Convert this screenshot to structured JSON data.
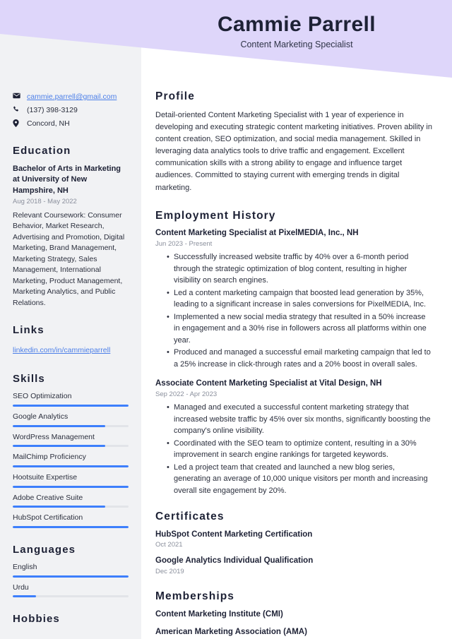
{
  "header": {
    "name": "Cammie Parrell",
    "job_title": "Content Marketing Specialist",
    "band_color": "#ded6fa"
  },
  "theme": {
    "accent": "#3d7ffc",
    "link": "#4c7fe8",
    "sidebar_bg": "#f1f2f4",
    "text": "#2b2f3d",
    "muted": "#8a8f9c"
  },
  "sidebar": {
    "contact": [
      {
        "icon": "envelope-icon",
        "value": "cammie.parrell@gmail.com",
        "is_link": true
      },
      {
        "icon": "phone-icon",
        "value": "(137) 398-3129",
        "is_link": false
      },
      {
        "icon": "location-pin-icon",
        "value": "Concord, NH",
        "is_link": false
      }
    ],
    "education": {
      "heading": "Education",
      "degree": "Bachelor of Arts in Marketing at University of New Hampshire, NH",
      "date": "Aug 2018 - May 2022",
      "description": "Relevant Coursework: Consumer Behavior, Market Research, Advertising and Promotion, Digital Marketing, Brand Management, Marketing Strategy, Sales Management, International Marketing, Product Management, Marketing Analytics, and Public Relations."
    },
    "links": {
      "heading": "Links",
      "items": [
        {
          "label": "linkedin.com/in/cammieparrell"
        }
      ]
    },
    "skills": {
      "heading": "Skills",
      "items": [
        {
          "label": "SEO Optimization",
          "level": 100
        },
        {
          "label": "Google Analytics",
          "level": 80
        },
        {
          "label": "WordPress Management",
          "level": 80
        },
        {
          "label": "MailChimp Proficiency",
          "level": 100
        },
        {
          "label": "Hootsuite Expertise",
          "level": 100
        },
        {
          "label": "Adobe Creative Suite",
          "level": 80
        },
        {
          "label": "HubSpot Certification",
          "level": 100
        }
      ]
    },
    "languages": {
      "heading": "Languages",
      "items": [
        {
          "label": "English",
          "level": 100
        },
        {
          "label": "Urdu",
          "level": 20
        }
      ]
    },
    "hobbies": {
      "heading": "Hobbies"
    }
  },
  "main": {
    "profile": {
      "heading": "Profile",
      "text": "Detail-oriented Content Marketing Specialist with 1 year of experience in developing and executing strategic content marketing initiatives. Proven ability in content creation, SEO optimization, and social media management. Skilled in leveraging data analytics tools to drive traffic and engagement. Excellent communication skills with a strong ability to engage and influence target audiences. Committed to staying current with emerging trends in digital marketing."
    },
    "employment": {
      "heading": "Employment History",
      "jobs": [
        {
          "title": "Content Marketing Specialist at PixelMEDIA, Inc., NH",
          "date": "Jun 2023 - Present",
          "bullets": [
            "Successfully increased website traffic by 40% over a 6-month period through the strategic optimization of blog content, resulting in higher visibility on search engines.",
            "Led a content marketing campaign that boosted lead generation by 35%, leading to a significant increase in sales conversions for PixelMEDIA, Inc.",
            "Implemented a new social media strategy that resulted in a 50% increase in engagement and a 30% rise in followers across all platforms within one year.",
            "Produced and managed a successful email marketing campaign that led to a 25% increase in click-through rates and a 20% boost in overall sales."
          ]
        },
        {
          "title": "Associate Content Marketing Specialist at Vital Design, NH",
          "date": "Sep 2022 - Apr 2023",
          "bullets": [
            "Managed and executed a successful content marketing strategy that increased website traffic by 45% over six months, significantly boosting the company's online visibility.",
            "Coordinated with the SEO team to optimize content, resulting in a 30% improvement in search engine rankings for targeted keywords.",
            "Led a project team that created and launched a new blog series, generating an average of 10,000 unique visitors per month and increasing overall site engagement by 20%."
          ]
        }
      ]
    },
    "certificates": {
      "heading": "Certificates",
      "items": [
        {
          "title": "HubSpot Content Marketing Certification",
          "date": "Oct 2021"
        },
        {
          "title": "Google Analytics Individual Qualification",
          "date": "Dec 2019"
        }
      ]
    },
    "memberships": {
      "heading": "Memberships",
      "items": [
        {
          "label": "Content Marketing Institute (CMI)"
        },
        {
          "label": "American Marketing Association (AMA)"
        }
      ]
    }
  }
}
